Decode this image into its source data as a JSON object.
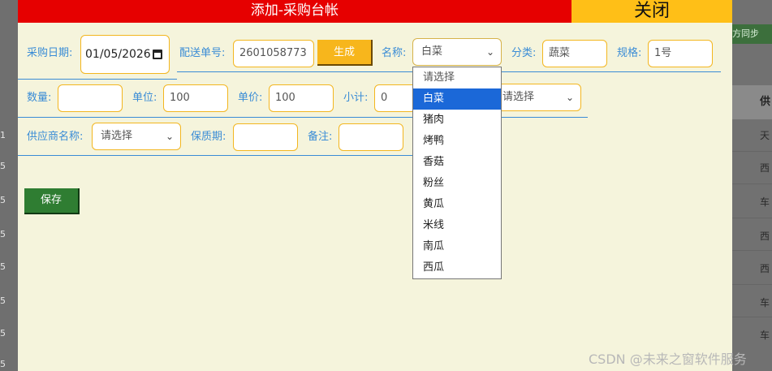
{
  "modal": {
    "title": "添加-采购台帐",
    "close_label": "关闭"
  },
  "form": {
    "purchase_date": {
      "label": "采购日期:",
      "value": "01/05/2026"
    },
    "delivery_no": {
      "label": "配送单号:",
      "value": "2601058773",
      "generate_label": "生成"
    },
    "name": {
      "label": "名称:",
      "value": "白菜"
    },
    "category": {
      "label": "分类:",
      "value": "蔬菜"
    },
    "spec": {
      "label": "规格:",
      "value": "1号"
    },
    "quantity": {
      "label": "数量:",
      "value": ""
    },
    "unit": {
      "label": "单位:",
      "value": "100"
    },
    "unit_price": {
      "label": "单价:",
      "value": "100"
    },
    "subtotal": {
      "label": "小计:",
      "value": "0"
    },
    "hidden_select": {
      "value": "请选择"
    },
    "supplier": {
      "label": "供应商名称:",
      "value": "请选择"
    },
    "shelf_life": {
      "label": "保质期:",
      "value": ""
    },
    "remark": {
      "label": "备注:",
      "value": ""
    },
    "save_label": "保存"
  },
  "dropdown": {
    "options": [
      "请选择",
      "白菜",
      "猪肉",
      "烤鸭",
      "香菇",
      "粉丝",
      "黄瓜",
      "米线",
      "南瓜",
      "西瓜"
    ],
    "selected": "白菜"
  },
  "background": {
    "sync_label": "方同步",
    "column_header": "供",
    "right_cells": [
      "天",
      "西",
      "车",
      "西",
      "西",
      "车",
      "车"
    ],
    "left_numbers": [
      "1",
      "5",
      "5",
      "5",
      "5",
      "5",
      "5",
      "5"
    ]
  },
  "watermark": "CSDN @未来之窗软件服务"
}
